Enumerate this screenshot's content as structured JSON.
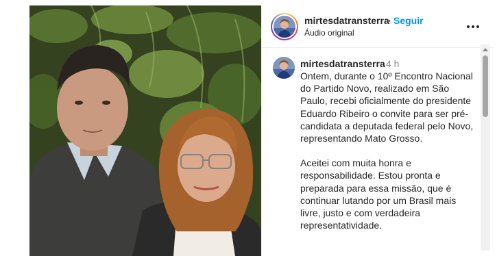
{
  "post": {
    "username": "mirtesdatransterra",
    "separator": "•",
    "follow_label": "Seguir",
    "audio_label": "Áudio original"
  },
  "caption": {
    "username": "mirtesdatransterra",
    "time": "4 h",
    "paragraph_1": "Ontem, durante o 10º Encontro Nacional do Partido Novo, realizado em São Paulo, recebi oficialmente do presidente Eduardo Ribeiro o convite para ser pré-candidata a deputada federal pelo Novo, representando Mato Grosso.",
    "paragraph_2": "Aceitei com muita honra e responsabilidade. Estou pronta e preparada para essa missão, que é continuar lutando por um Brasil mais livre, justo e com verdadeira representatividade."
  },
  "icons": {
    "more": "more-options-icon",
    "scroll_up": "scroll-up-arrow-icon"
  },
  "colors": {
    "link_blue": "#0095f6",
    "text": "#262626",
    "muted": "#737373"
  }
}
